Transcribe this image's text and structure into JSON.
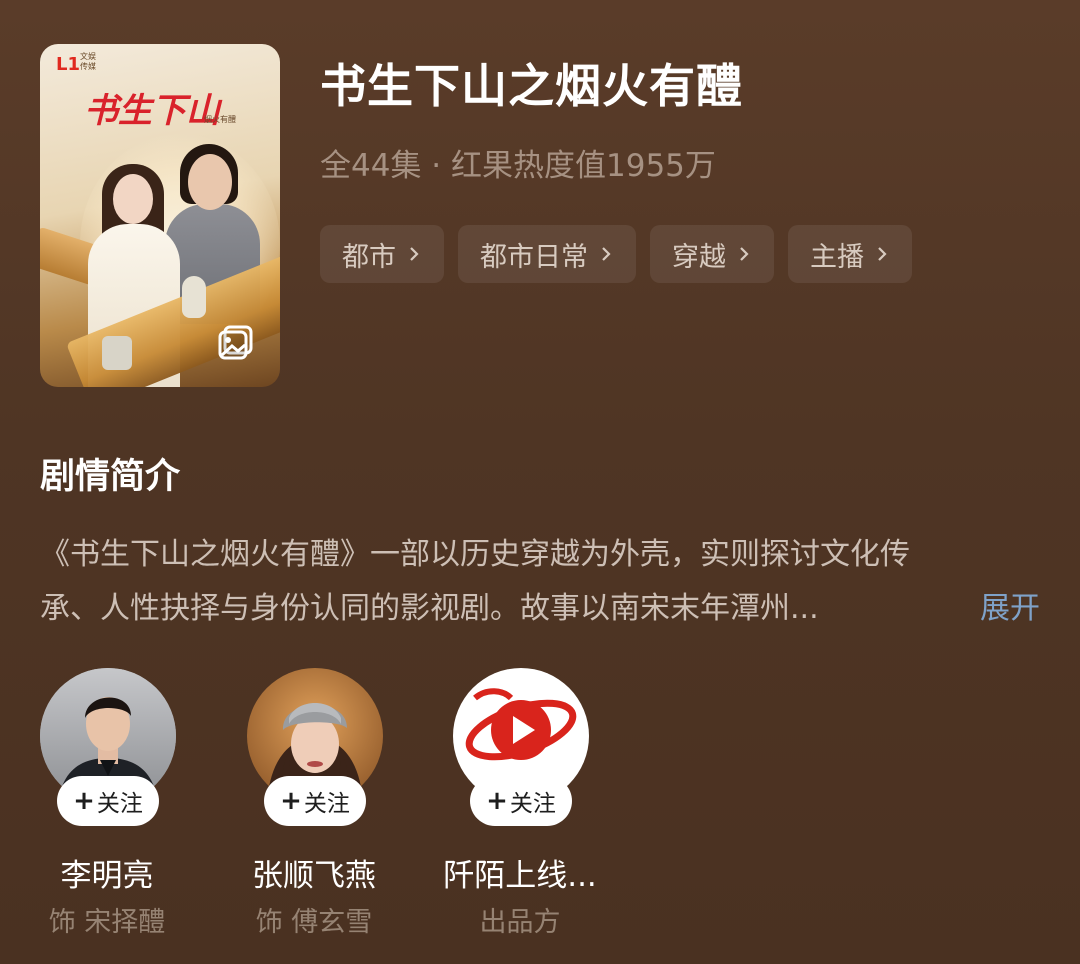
{
  "drama": {
    "title": "书生下山之烟火有醴",
    "meta": "全44集 · 红果热度值1955万",
    "poster": {
      "title_art": "书生下山",
      "subtitle": "烟火有醴",
      "logo_text": "文娱 传媒"
    },
    "tags": [
      {
        "label": "都市"
      },
      {
        "label": "都市日常"
      },
      {
        "label": "穿越"
      },
      {
        "label": "主播"
      }
    ]
  },
  "synopsis": {
    "heading": "剧情简介",
    "line1": "《书生下山之烟火有醴》一部以历史穿越为外壳，实则探讨文化传",
    "line2": "承、人性抉择与身份认同的影视剧。故事以南宋末年潭州...",
    "expand_label": "展开"
  },
  "people": [
    {
      "name": "李明亮",
      "role": "饰 宋择醴",
      "follow_label": "关注",
      "follow_plus": "+",
      "avatar": "actor-photo"
    },
    {
      "name": "张顺飞燕",
      "role": "饰 傅玄雪",
      "follow_label": "关注",
      "follow_plus": "+",
      "avatar": "actress-photo"
    },
    {
      "name": "阡陌上线...",
      "role": "出品方",
      "follow_label": "关注",
      "follow_plus": "+",
      "avatar": "producer-logo"
    }
  ],
  "colors": {
    "background": "#4e3423",
    "expand_link": "#7fa2c9",
    "brand_red": "#e0291f"
  }
}
